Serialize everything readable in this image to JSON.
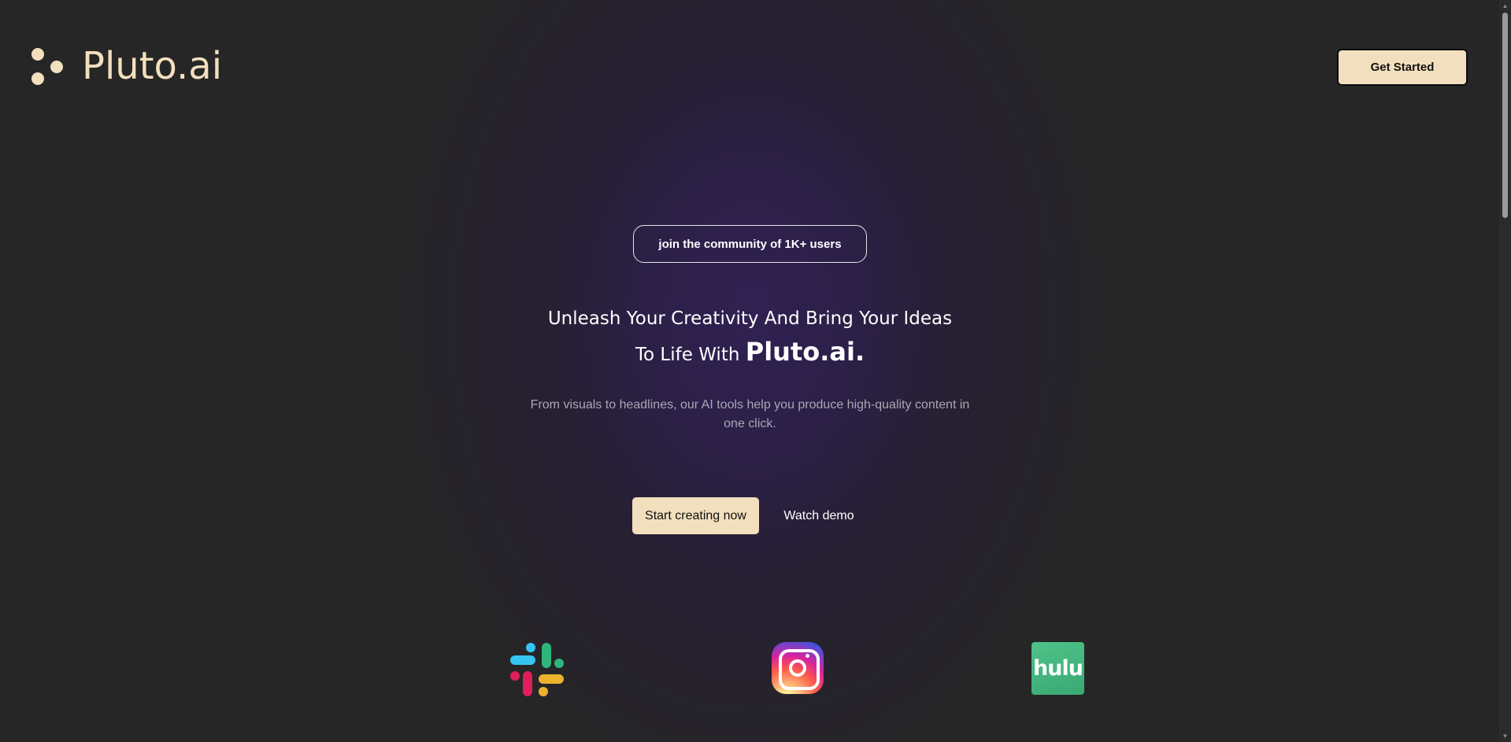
{
  "header": {
    "logo_text": "Pluto.ai",
    "get_started_label": "Get Started"
  },
  "hero": {
    "community_pill": "join the community of 1K+ users",
    "headline_line1": "Unleash Your Creativity And Bring Your Ideas",
    "headline_line2_prefix": "To Life With ",
    "headline_brand": "Pluto.ai.",
    "subtext": "From visuals to headlines, our AI tools help you produce high-quality content in one click.",
    "primary_cta": "Start creating now",
    "secondary_cta": "Watch demo"
  },
  "logos": {
    "items": [
      {
        "name": "slack-icon"
      },
      {
        "name": "instagram-icon"
      },
      {
        "name": "hulu-icon",
        "text": "hulu"
      }
    ]
  },
  "colors": {
    "background": "#262626",
    "accent": "#f2dfbd",
    "glow": "#302152",
    "subtext": "#a9a7b4"
  },
  "scrollbar": {
    "up_glyph": "▲",
    "down_glyph": "▼"
  }
}
